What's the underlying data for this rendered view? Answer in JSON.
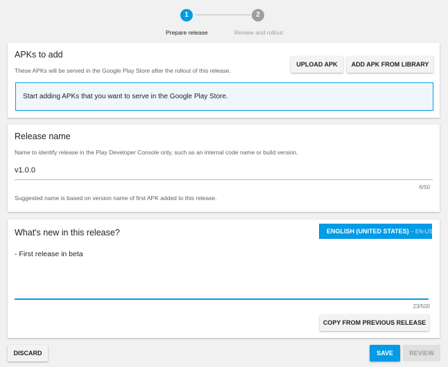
{
  "stepper": {
    "steps": [
      {
        "number": "1",
        "label": "Prepare release",
        "active": true
      },
      {
        "number": "2",
        "label": "Review and rollout",
        "active": false
      }
    ]
  },
  "apks": {
    "title": "APKs to add",
    "description": "These APKs will be served in the Google Play Store after the rollout of this release.",
    "upload_label": "UPLOAD APK",
    "library_label": "ADD APK FROM LIBRARY",
    "empty_message": "Start adding APKs that you want to serve in the Google Play Store."
  },
  "release_name": {
    "title": "Release name",
    "description": "Name to identify release in the Play Developer Console only, such as an internal code name or build version.",
    "value": "v1.0.0",
    "counter": "6/50",
    "hint": "Suggested name is based on version name of first APK added to this release."
  },
  "whats_new": {
    "title": "What's new in this release?",
    "language_label": "ENGLISH (UNITED STATES)",
    "language_code": "– EN-US",
    "text": "- First release in beta",
    "counter": "23/500",
    "copy_label": "COPY FROM PREVIOUS RELEASE"
  },
  "footer": {
    "discard_label": "DISCARD",
    "save_label": "SAVE",
    "review_label": "REVIEW"
  },
  "colors": {
    "accent": "#039be5",
    "inactive": "#9e9e9e"
  }
}
